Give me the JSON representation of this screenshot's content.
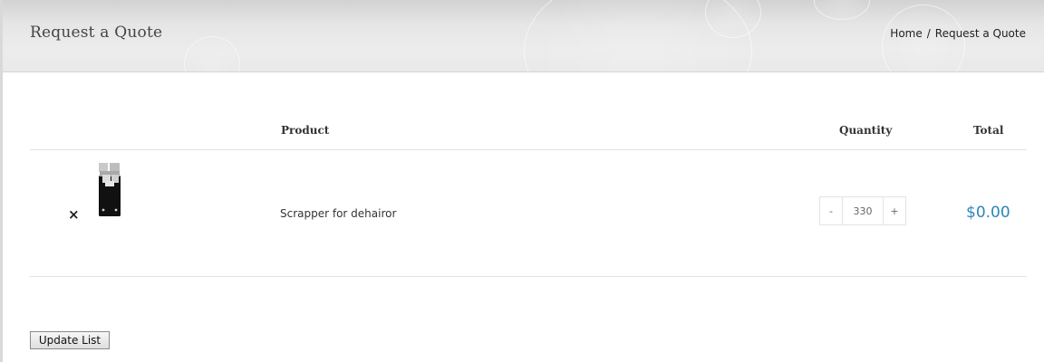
{
  "header": {
    "title": "Request a Quote",
    "breadcrumb": {
      "home": "Home",
      "separator": "/",
      "current": "Request a Quote"
    }
  },
  "table": {
    "columns": {
      "product": "Product",
      "quantity": "Quantity",
      "total": "Total"
    },
    "rows": [
      {
        "remove_symbol": "×",
        "product_name": "Scrapper for dehairor",
        "quantity": "330",
        "minus_label": "-",
        "plus_label": "+",
        "total": "$0.00"
      }
    ]
  },
  "actions": {
    "update_label": "Update List"
  },
  "colors": {
    "price": "#2b86b8",
    "header_bg": "#e6e6e6"
  }
}
